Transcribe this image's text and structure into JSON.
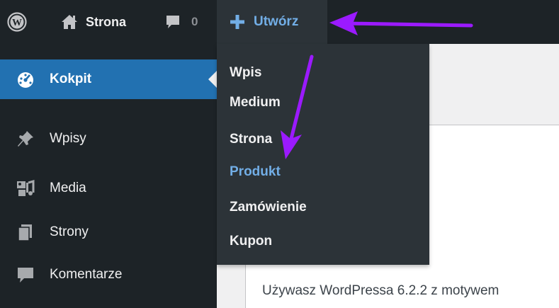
{
  "adminbar": {
    "site_name": "Strona",
    "comments_count": "0",
    "new_label": "Utwórz",
    "icons": {
      "logo": "wordpress-logo",
      "home": "home-icon",
      "comments": "comment-bubble-icon",
      "new": "plus-icon"
    }
  },
  "new_menu": {
    "items": [
      {
        "label": "Wpis"
      },
      {
        "label": "Medium"
      },
      {
        "label": "Strona"
      },
      {
        "label": "Produkt"
      },
      {
        "label": "Zamówienie"
      },
      {
        "label": "Kupon"
      }
    ],
    "highlighted": "Produkt"
  },
  "sidebar": {
    "items": [
      {
        "label": "Kokpit",
        "icon": "dashboard-icon",
        "active": true
      },
      {
        "label": "Wpisy",
        "icon": "pushpin-icon"
      },
      {
        "label": "Media",
        "icon": "media-icon"
      },
      {
        "label": "Strony",
        "icon": "pages-icon"
      },
      {
        "label": "Komentarze",
        "icon": "comment-icon"
      }
    ]
  },
  "content": {
    "version_text": "Używasz WordPressa 6.2.2 z motywem"
  },
  "colors": {
    "bar_bg": "#1d2327",
    "dropdown_bg": "#2c3338",
    "active_blue": "#2271b1",
    "link_blue": "#72aee6",
    "annotation_purple": "#9b1aff"
  }
}
